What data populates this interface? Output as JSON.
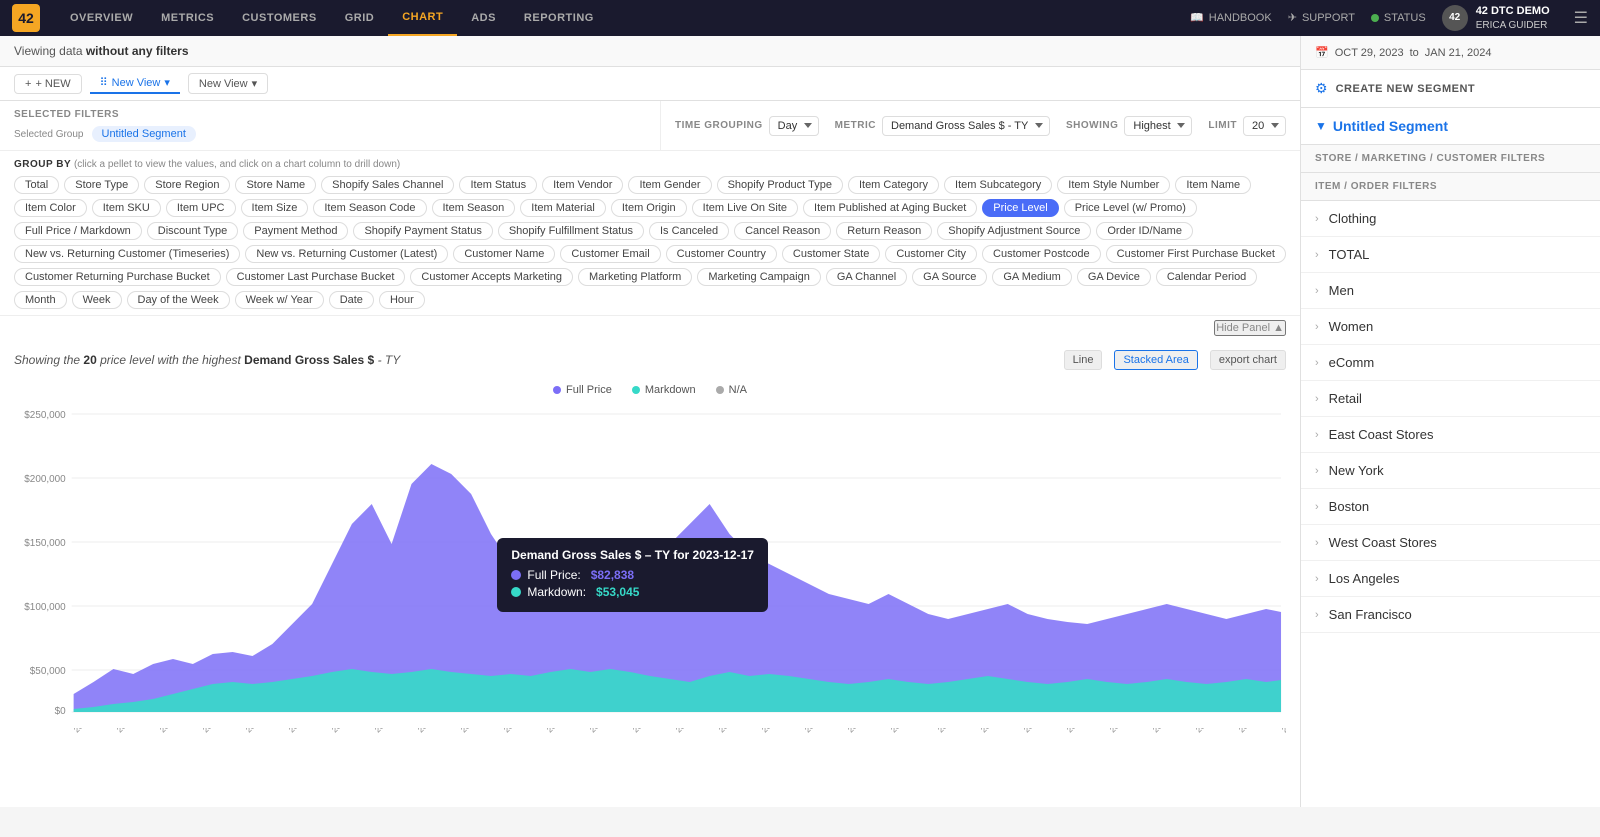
{
  "app": {
    "logo": "42",
    "logo_bg": "#f5a623"
  },
  "nav": {
    "items": [
      {
        "id": "overview",
        "label": "OVERVIEW",
        "active": false
      },
      {
        "id": "metrics",
        "label": "METRICS",
        "active": false
      },
      {
        "id": "customers",
        "label": "CUSTOMERS",
        "active": false
      },
      {
        "id": "grid",
        "label": "GRID",
        "active": false
      },
      {
        "id": "chart",
        "label": "CHART",
        "active": true
      },
      {
        "id": "ads",
        "label": "ADS",
        "active": false
      },
      {
        "id": "reporting",
        "label": "REPORTING",
        "active": false
      }
    ],
    "right": {
      "handbook": "HANDBOOK",
      "support": "SUPPORT",
      "status": "STATUS",
      "profile_initials": "42",
      "profile_name": "42 DTC DEMO",
      "profile_sub": "ERICA GUIDER"
    }
  },
  "info_bar": {
    "text": "Viewing data ",
    "highlight": "without any filters"
  },
  "date_range": {
    "from": "OCT 29, 2023",
    "to": "JAN 21, 2024"
  },
  "tabs": {
    "new_label": "+ NEW",
    "active_tab": "New View",
    "secondary_tab": "New View"
  },
  "filters": {
    "section_label": "SELECTED FILTERS",
    "group_label": "Selected Group",
    "group_value": "Untitled Segment"
  },
  "controls": {
    "time_grouping_label": "TIME GROUPING",
    "time_grouping_value": "Day",
    "metric_label": "METRIC",
    "metric_value": "Demand Gross Sales $ - TY",
    "showing_label": "SHOWING",
    "showing_value": "Highest",
    "limit_label": "LIMIT",
    "limit_value": "20"
  },
  "group_by": {
    "label": "GROUP BY",
    "hint": "(click a pellet to view the values, and click on a chart column to drill down)",
    "pellets": [
      "Total",
      "Store Type",
      "Store Region",
      "Store Name",
      "Shopify Sales Channel",
      "Item Status",
      "Item Vendor",
      "Item Gender",
      "Shopify Product Type",
      "Item Category",
      "Item Subcategory",
      "Item Style Number",
      "Item Name",
      "Item Color",
      "Item SKU",
      "Item UPC",
      "Item Size",
      "Item Season Code",
      "Item Season",
      "Item Material",
      "Item Origin",
      "Item Live On Site",
      "Item Published at Aging Bucket",
      "Price Level",
      "Price Level (w/ Promo)",
      "Full Price / Markdown",
      "Discount Type",
      "Payment Method",
      "Shopify Payment Status",
      "Shopify Fulfillment Status",
      "Is Canceled",
      "Cancel Reason",
      "Return Reason",
      "Shopify Adjustment Source",
      "Order ID/Name",
      "New vs. Returning Customer (Timeseries)",
      "New vs. Returning Customer (Latest)",
      "Customer Name",
      "Customer Email",
      "Customer Country",
      "Customer State",
      "Customer City",
      "Customer Postcode",
      "Customer First Purchase Bucket",
      "Customer Returning Purchase Bucket",
      "Customer Last Purchase Bucket",
      "Customer Accepts Marketing",
      "Marketing Platform",
      "Marketing Campaign",
      "GA Channel",
      "GA Source",
      "GA Medium",
      "GA Device",
      "Calendar Period",
      "Month",
      "Week",
      "Day of the Week",
      "Week w/ Year",
      "Date",
      "Hour"
    ],
    "active_pellet": "Price Level"
  },
  "hide_panel": "Hide Panel ▲",
  "chart": {
    "subtitle_prefix": "Showing the ",
    "subtitle_number": "20",
    "subtitle_middle": " price level with the highest ",
    "subtitle_metric": "Demand Gross Sales $",
    "subtitle_suffix": " - TY",
    "btn_line": "Line",
    "btn_stacked": "Stacked Area",
    "btn_export": "export chart",
    "legend": [
      {
        "label": "Full Price",
        "color": "#7c6ef7"
      },
      {
        "label": "Markdown",
        "color": "#36d9c8"
      },
      {
        "label": "N/A",
        "color": "#aaa"
      }
    ],
    "y_axis": [
      "$250,000",
      "$200,000",
      "$150,000",
      "$100,000",
      "$50,000",
      "$0"
    ],
    "tooltip": {
      "title": "Demand Gross Sales $ – TY for 2023-12-17",
      "full_price_label": "Full Price:",
      "full_price_value": "$82,838",
      "markdown_label": "Markdown:",
      "markdown_value": "$53,045"
    }
  },
  "right_sidebar": {
    "settings_icon": "⚙",
    "create_segment_label": "CREATE NEW SEGMENT",
    "segment_title": "Untitled Segment",
    "section_store": "STORE / MARKETING / CUSTOMER FILTERS",
    "section_item": "ITEM / ORDER FILTERS",
    "items": [
      "Clothing",
      "TOTAL",
      "Men",
      "Women",
      "eComm",
      "Retail",
      "East Coast Stores",
      "New York",
      "Boston",
      "West Coast Stores",
      "Los Angeles",
      "San Francisco"
    ]
  }
}
